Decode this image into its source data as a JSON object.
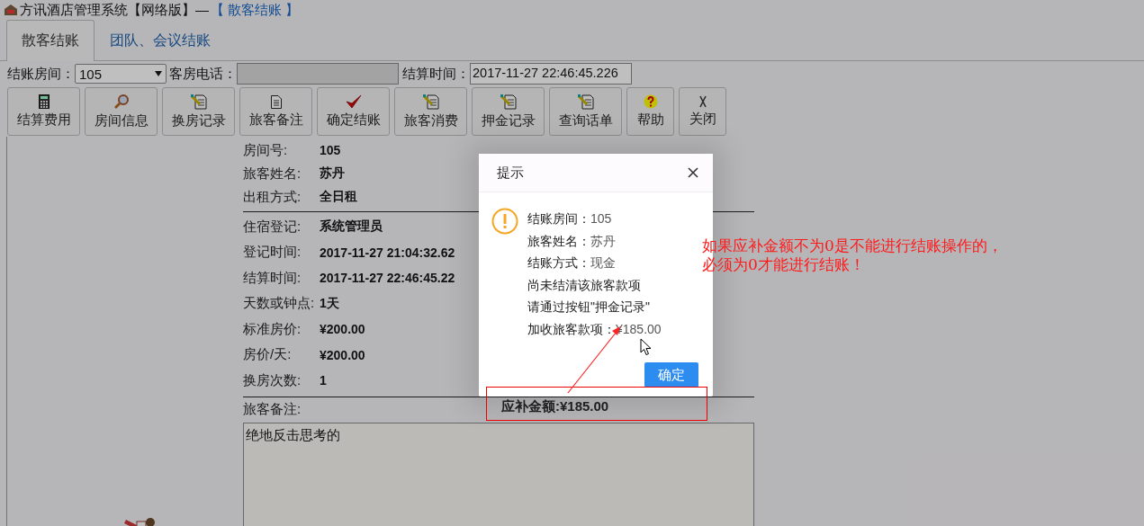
{
  "window": {
    "title": "方讯酒店管理系统【网络版】—",
    "subtitle": "【 散客结账 】"
  },
  "tabs": [
    {
      "label": "散客结账",
      "selected": true
    },
    {
      "label": "团队、会议结账",
      "selected": false
    }
  ],
  "filter": {
    "room_label": "结账房间：",
    "room_value": "105",
    "phone_label": "客房电话：",
    "time_label": "结算时间：",
    "time_value": "2017-11-27 22:46:45.226"
  },
  "toolbar": [
    {
      "label": "结算费用",
      "kind": "calculator"
    },
    {
      "label": "房间信息",
      "kind": "magnifier"
    },
    {
      "label": "换房记录",
      "kind": "document-pen"
    },
    {
      "label": "旅客备注",
      "kind": "document"
    },
    {
      "label": "确定结账",
      "kind": "check"
    },
    {
      "label": "旅客消费",
      "kind": "document-pen"
    },
    {
      "label": "押金记录",
      "kind": "document-pen"
    },
    {
      "label": "查询话单",
      "kind": "document-pen"
    },
    {
      "label": "帮助",
      "kind": "help"
    },
    {
      "label": "关闭",
      "kind": "close"
    }
  ],
  "details": [
    [
      {
        "label": "房间号:",
        "value": "105"
      },
      {
        "label": "旅客姓名:",
        "value": "苏丹"
      },
      {
        "label": "出租方式:",
        "value": "全日租"
      }
    ],
    [
      {
        "label": "住宿登记:",
        "value": "系统管理员"
      },
      {
        "label": "登记时间:",
        "value": "2017-11-27 21:04:32.62"
      },
      {
        "label": "结算时间:",
        "value": "2017-11-27 22:46:45.22"
      },
      {
        "label": "天数或钟点:",
        "value": "1天"
      },
      {
        "label": "标准房价:",
        "value": "¥200.00"
      },
      {
        "label": "房价/天:",
        "value": "¥200.00"
      },
      {
        "label": "换房次数:",
        "value": "1"
      }
    ]
  ],
  "notes": {
    "label": "旅客备注:",
    "amount_due": "应补金额:¥185.00",
    "value": "绝地反击思考的"
  },
  "dialog": {
    "title": "提示",
    "lines": [
      {
        "label": "结账房间：",
        "value": "105"
      },
      {
        "label": "旅客姓名：",
        "value": "苏丹"
      },
      {
        "label": "结账方式：",
        "value": "现金"
      },
      {
        "label": "尚未结清该旅客款项"
      },
      {
        "label": "请通过按钮\"押金记录\""
      },
      {
        "label": "加收旅客款项：",
        "value": "¥185.00"
      }
    ],
    "button": "确定"
  },
  "annotation": {
    "lines": [
      "如果应补金额不为0是不能进行结账操作的，",
      "必须为0才能进行结账！"
    ]
  }
}
